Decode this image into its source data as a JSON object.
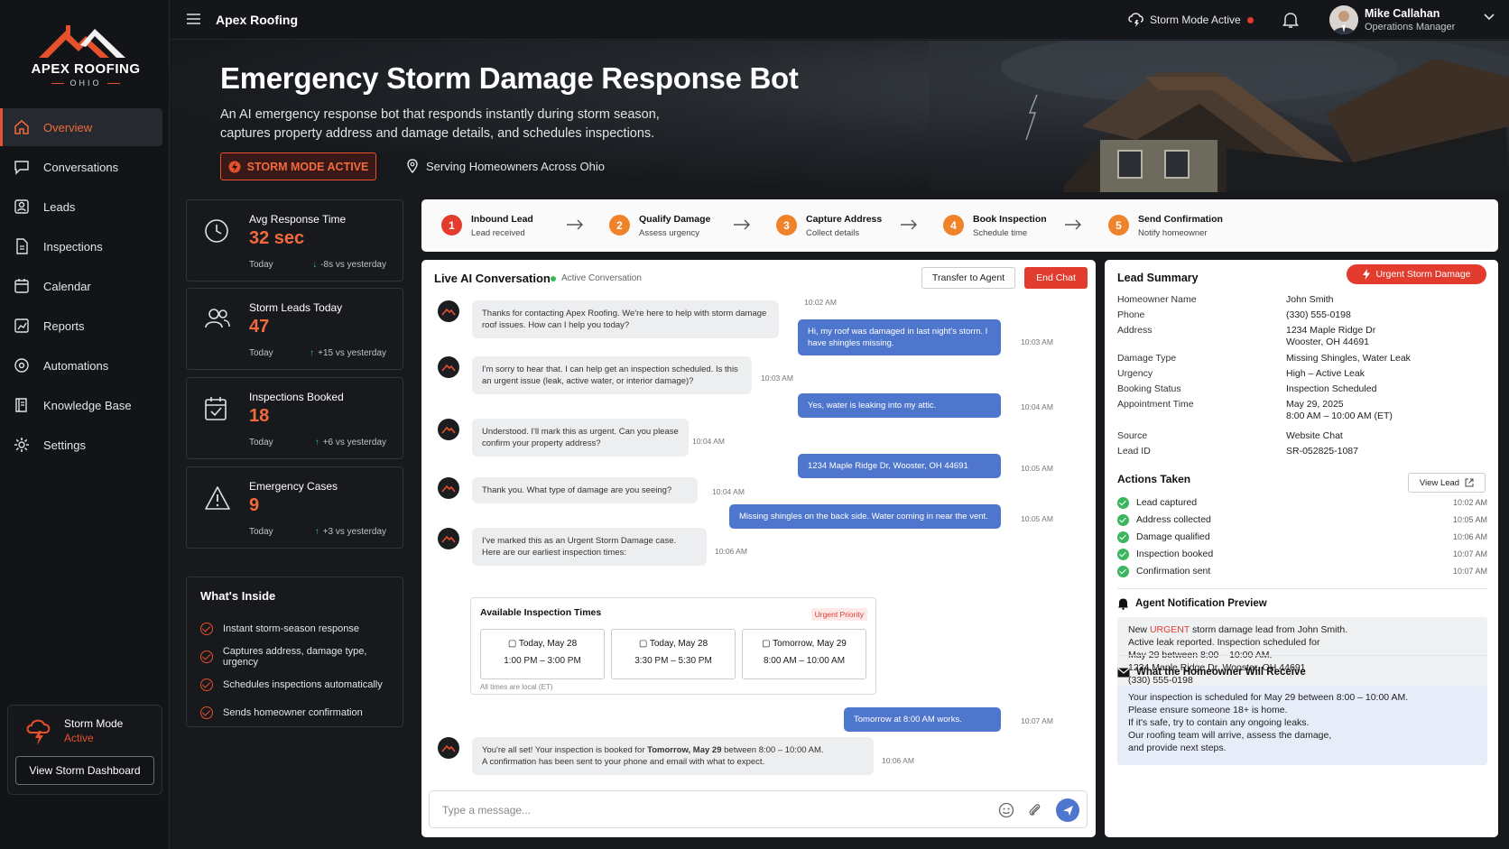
{
  "brand": {
    "logo_name": "APEX ROOFING",
    "logo_sub": "OHIO",
    "app_title": "Apex Roofing"
  },
  "colors": {
    "accent": "#e5512c",
    "primary_blue": "#4f76cd",
    "danger": "#e23c2e",
    "success": "#3cb560"
  },
  "nav": [
    {
      "label": "Overview",
      "icon": "home-icon",
      "active": true
    },
    {
      "label": "Conversations",
      "icon": "chat-icon"
    },
    {
      "label": "Leads",
      "icon": "contact-icon"
    },
    {
      "label": "Inspections",
      "icon": "document-icon"
    },
    {
      "label": "Calendar",
      "icon": "calendar-icon"
    },
    {
      "label": "Reports",
      "icon": "chart-icon"
    },
    {
      "label": "Automations",
      "icon": "automation-icon"
    },
    {
      "label": "Knowledge Base",
      "icon": "book-icon"
    },
    {
      "label": "Settings",
      "icon": "gear-icon"
    }
  ],
  "storm_card": {
    "title": "Storm Mode",
    "status": "Active",
    "button": "View Storm Dashboard"
  },
  "topbar": {
    "storm_mode": "Storm Mode Active",
    "user_name": "Mike Callahan",
    "user_role": "Operations Manager"
  },
  "hero": {
    "title": "Emergency Storm Damage Response Bot",
    "subtitle": "An AI emergency response bot that responds instantly during storm season, captures property address and damage details, and schedules inspections.",
    "badge": "STORM MODE ACTIVE",
    "location": "Serving Homeowners Across Ohio"
  },
  "stats": [
    {
      "label": "Avg Response Time",
      "value": "32 sec",
      "period": "Today",
      "delta": "-8s vs yesterday",
      "icon": "clock-icon"
    },
    {
      "label": "Storm Leads Today",
      "value": "47",
      "period": "Today",
      "delta": "+15 vs yesterday",
      "icon": "users-icon"
    },
    {
      "label": "Inspections Booked",
      "value": "18",
      "period": "Today",
      "delta": "+6 vs yesterday",
      "icon": "calendar-check-icon"
    },
    {
      "label": "Emergency Cases",
      "value": "9",
      "period": "Today",
      "delta": "+3 vs yesterday",
      "icon": "warning-icon"
    }
  ],
  "inside": {
    "title": "What's Inside",
    "items": [
      "Instant storm-season response",
      "Captures address, damage type, urgency",
      "Schedules inspections automatically",
      "Sends homeowner confirmation"
    ]
  },
  "pipeline": [
    {
      "num": "1",
      "title": "Inbound Lead",
      "sub": "Lead received",
      "color": "#e23c2e"
    },
    {
      "num": "2",
      "title": "Qualify Damage",
      "sub": "Assess urgency",
      "color": "#f0832a"
    },
    {
      "num": "3",
      "title": "Capture Address",
      "sub": "Collect details",
      "color": "#f0832a"
    },
    {
      "num": "4",
      "title": "Book Inspection",
      "sub": "Schedule time",
      "color": "#f0832a"
    },
    {
      "num": "5",
      "title": "Send Confirmation",
      "sub": "Notify homeowner",
      "color": "#f0832a"
    }
  ],
  "conversation": {
    "title": "Live AI Conversation",
    "status": "Active Conversation",
    "transfer": "Transfer to Agent",
    "end": "End Chat",
    "messages": {
      "b1": "Thanks for contacting Apex Roofing. We're here to help with storm damage roof issues. How can I help you today?",
      "b1_time": "10:02 AM",
      "u1": "Hi, my roof was damaged in last night's storm. I have shingles missing.",
      "u1_time": "10:03 AM",
      "b2": "I'm sorry to hear that. I can help get an inspection scheduled. Is this an urgent issue (leak, active water, or interior damage)?",
      "b2_time": "10:03 AM",
      "u2": "Yes, water is leaking into my attic.",
      "u2_time": "10:04 AM",
      "b3": "Understood. I'll mark this as urgent. Can you please confirm your property address?",
      "b3_time": "10:04 AM",
      "u3": "1234 Maple Ridge Dr, Wooster, OH 44691",
      "u3_time": "10:05 AM",
      "b4": "Thank you. What type of damage are you seeing?",
      "b4_time": "10:04 AM",
      "u4": "Missing shingles on the back side. Water coming in near the vent.",
      "u4_time": "10:05 AM",
      "b5": "I've marked this as an Urgent Storm Damage case. Here are our earliest inspection times:",
      "b5_time": "10:06 AM",
      "u5": "Tomorrow at 8:00 AM works.",
      "u5_time": "10:07 AM",
      "b6_a": "You're all set! Your inspection is booked for ",
      "b6_bold": "Tomorrow, May 29",
      "b6_b": " between 8:00 – 10:00 AM.",
      "b6_c": "A confirmation has been sent to your phone and email with what to expect.",
      "b6_time": "10:06 AM"
    },
    "slots": {
      "title": "Available Inspection Times",
      "priority": "Urgent Priority",
      "items": [
        {
          "day": "Today, May 28",
          "hours": "1:00 PM – 3:00 PM"
        },
        {
          "day": "Today, May 28",
          "hours": "3:30 PM – 5:30 PM"
        },
        {
          "day": "Tomorrow, May 29",
          "hours": "8:00 AM – 10:00 AM"
        }
      ],
      "note": "All times are local (ET)"
    },
    "input_placeholder": "Type a message..."
  },
  "lead": {
    "title": "Lead Summary",
    "badge": "Urgent Storm Damage",
    "fields": [
      {
        "k": "Homeowner Name",
        "v": "John Smith"
      },
      {
        "k": "Phone",
        "v": "(330) 555-0198"
      },
      {
        "k": "Address",
        "v": "1234 Maple Ridge Dr",
        "v2": "Wooster, OH 44691"
      },
      {
        "k": "Damage Type",
        "v": "Missing Shingles, Water Leak"
      },
      {
        "k": "Urgency",
        "v": "High – Active Leak"
      },
      {
        "k": "Booking Status",
        "v": "Inspection Scheduled"
      },
      {
        "k": "Appointment Time",
        "v": "May 29, 2025",
        "v2": "8:00 AM – 10:00 AM (ET)"
      },
      {
        "k": "Source",
        "v": "Website Chat"
      },
      {
        "k": "Lead ID",
        "v": "SR-052825-1087"
      }
    ],
    "actions_title": "Actions Taken",
    "view_lead": "View Lead",
    "actions": [
      {
        "label": "Lead captured",
        "time": "10:02 AM"
      },
      {
        "label": "Address collected",
        "time": "10:05 AM"
      },
      {
        "label": "Damage qualified",
        "time": "10:06 AM"
      },
      {
        "label": "Inspection booked",
        "time": "10:07 AM"
      },
      {
        "label": "Confirmation sent",
        "time": "10:07 AM"
      }
    ],
    "notif_title": "Agent Notification Preview",
    "notif": {
      "pre": "New ",
      "urgent": "URGENT",
      "l1": " storm damage lead from John Smith.",
      "l2": "Active leak reported. Inspection scheduled for",
      "l3": "May 29 between 8:00 – 10:00 AM.",
      "l4": "1234 Maple Ridge Dr, Wooster, OH 44691",
      "l5": "(330) 555-0198"
    },
    "receive_title": "What the Homeowner Will Receive",
    "receive": [
      "Your inspection is scheduled for May 29 between 8:00 – 10:00 AM.",
      "Please ensure someone 18+ is home.",
      "If it's safe, try to contain any ongoing leaks.",
      "Our roofing team will arrive, assess the damage,",
      "and provide next steps."
    ]
  }
}
